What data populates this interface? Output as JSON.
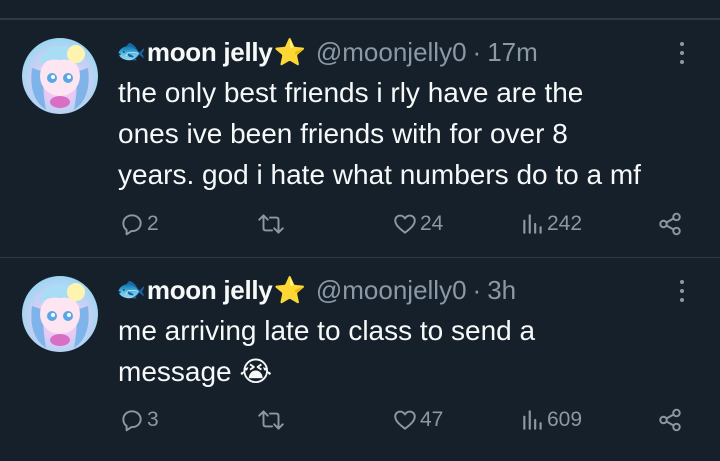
{
  "tweets": [
    {
      "display_name": "moon jelly",
      "name_prefix_emoji": "🐟",
      "name_suffix_emoji": "⭐",
      "handle": "@moonjelly0",
      "separator": "·",
      "time": "17m",
      "text_lines": [
        "the only best friends i rly have are the",
        "ones ive been friends with for over 8",
        "years. god i hate what numbers do to a mf"
      ],
      "replies": "2",
      "reposts": "",
      "likes": "24",
      "views": "242"
    },
    {
      "display_name": "moon jelly",
      "name_prefix_emoji": "🐟",
      "name_suffix_emoji": "⭐",
      "handle": "@moonjelly0",
      "separator": "·",
      "time": "3h",
      "text_lines": [
        "me arriving late to class to send a",
        "message 😭"
      ],
      "replies": "3",
      "reposts": "",
      "likes": "47",
      "views": "609"
    }
  ],
  "icons": {
    "reply": "reply-icon",
    "repost": "repost-icon",
    "like": "like-icon",
    "views": "views-icon",
    "share": "share-icon",
    "more": "more-icon"
  },
  "colors": {
    "background": "#15202b",
    "text": "#f7f9f9",
    "secondary": "#8b98a5",
    "divider": "#2f3a45"
  }
}
